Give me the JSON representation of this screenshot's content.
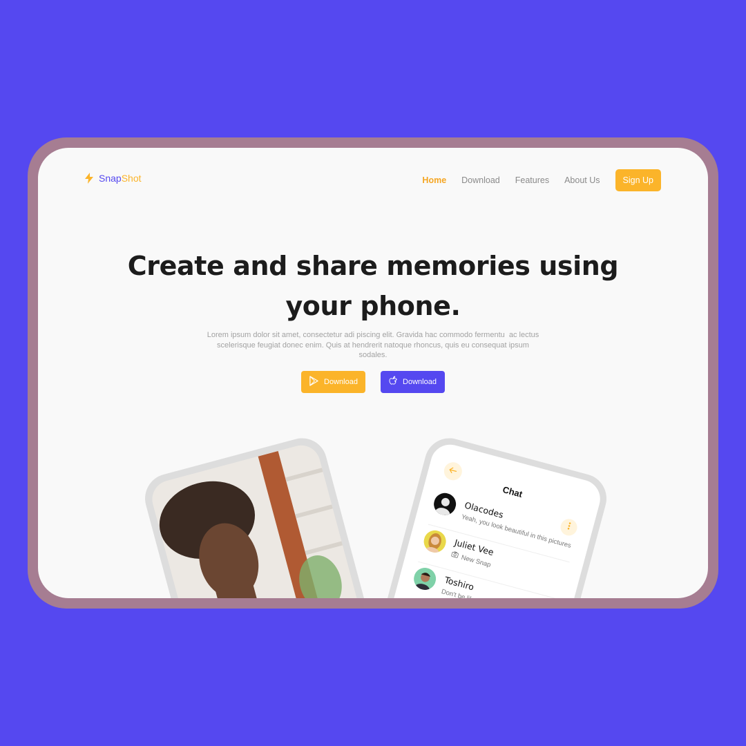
{
  "brand": {
    "name_part1": "Snap",
    "name_part2": "Shot",
    "icon": "bolt-icon"
  },
  "nav": {
    "links": [
      "Home",
      "Download",
      "Features",
      "About Us"
    ],
    "active": "Home",
    "signup_label": "Sign Up"
  },
  "hero": {
    "headline_line1": "Create and share memories using",
    "headline_line2": "your phone.",
    "subtext_line1": "Lorem ipsum dolor sit amet, consectetur adi piscing elit. Gravida hac commodo fermentu  ac lectus",
    "subtext_line2": "scelerisque feugiat donec enim. Quis at hendrerit natoque rhoncus, quis eu consequat ipsum",
    "subtext_line3": "sodales.",
    "buttons": [
      {
        "label": "Download",
        "icon": "play-store-icon"
      },
      {
        "label": "Download",
        "icon": "apple-icon"
      }
    ]
  },
  "chat": {
    "title": "Chat",
    "items": [
      {
        "name": "Olacodes",
        "message": "Yeah, you look beautiful in this pictures"
      },
      {
        "name": "Juliet Vee",
        "message": "New Snap",
        "icon": "camera-icon"
      },
      {
        "name": "Toshiro",
        "message": "Don't be like that"
      }
    ]
  },
  "colors": {
    "primary": "#5548F0",
    "accent": "#FBB42A",
    "frame": "#A67D92"
  }
}
